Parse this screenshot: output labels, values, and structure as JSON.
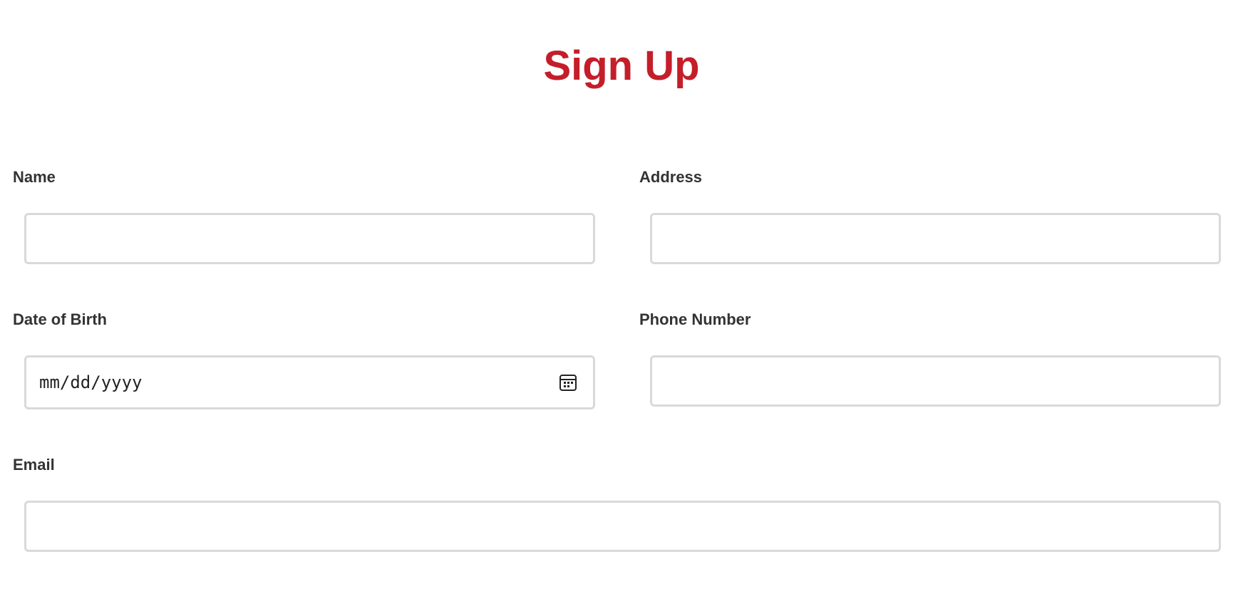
{
  "form": {
    "title": "Sign Up",
    "name": {
      "label": "Name",
      "value": ""
    },
    "address": {
      "label": "Address",
      "value": ""
    },
    "dob": {
      "label": "Date of Birth",
      "placeholder": "mm/dd/yyyy",
      "icon": "calendar-icon"
    },
    "phone": {
      "label": "Phone Number",
      "value": ""
    },
    "email": {
      "label": "Email",
      "value": ""
    }
  },
  "colors": {
    "title": "#c41e2a",
    "label": "#333333",
    "input_border": "#d9d9d9"
  }
}
